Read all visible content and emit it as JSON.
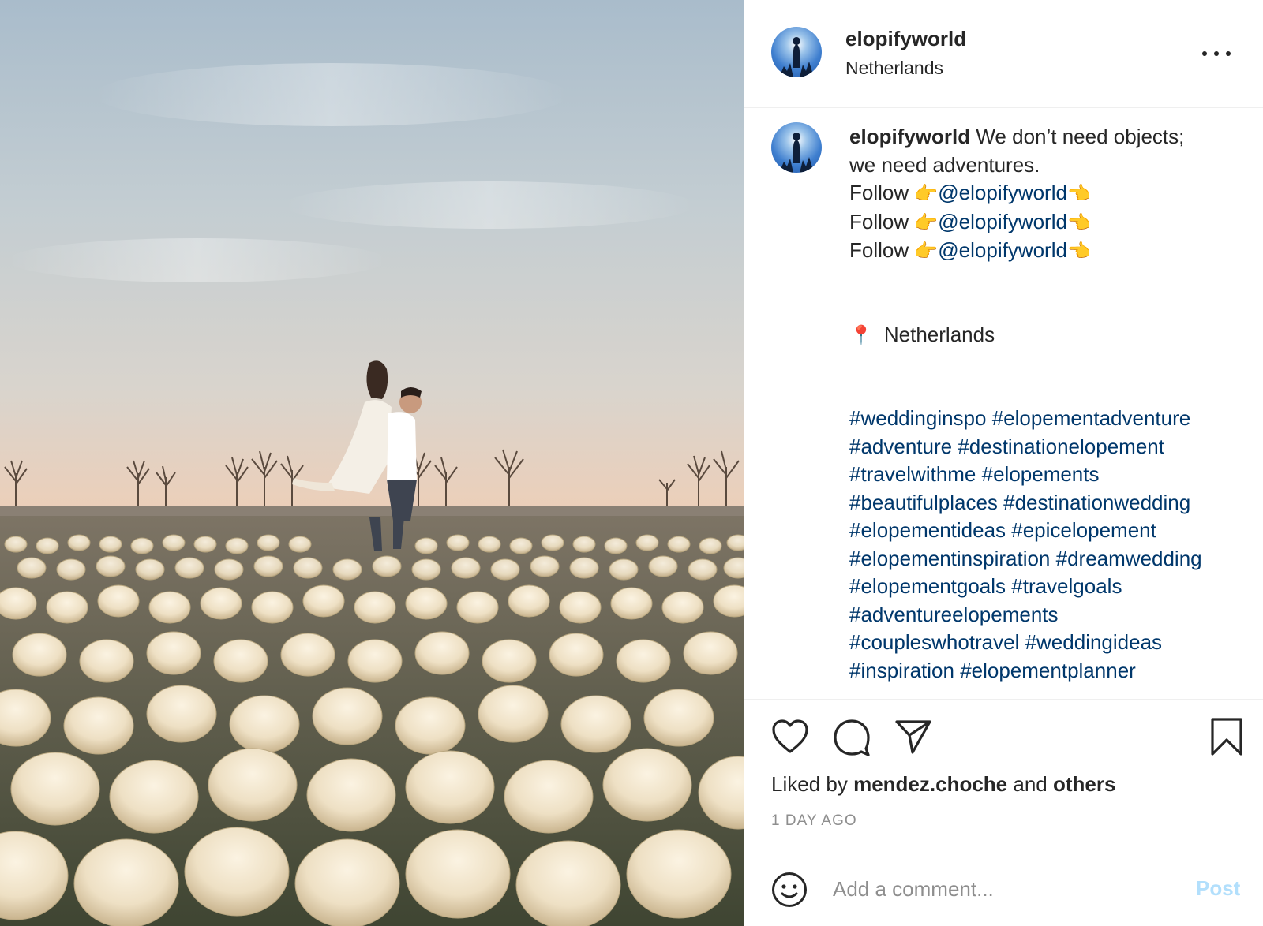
{
  "post": {
    "username": "elopifyworld",
    "location": "Netherlands"
  },
  "caption": {
    "username": "elopifyworld",
    "text_line1": " We don’t need objects;",
    "text_line2": "we need adventures.",
    "follow_lines": [
      {
        "word": "Follow",
        "emoji_left": "👉",
        "mention": "@elopifyworld",
        "emoji_right": "👈"
      },
      {
        "word": "Follow",
        "emoji_left": "👉",
        "mention": "@elopifyworld",
        "emoji_right": "👈"
      },
      {
        "word": "Follow",
        "emoji_left": "👉",
        "mention": "@elopifyworld",
        "emoji_right": "👈"
      }
    ],
    "location_pin": "📍",
    "location_text": "Netherlands",
    "hashtag_lines": [
      "#weddinginspo #elopementadventure",
      "#adventure #destinationelopement",
      "#travelwithme #elopements",
      "#beautifulplaces #destinationwedding",
      "#elopementideas #epicelopement",
      "#elopementinspiration #dreamwedding",
      "#elopementgoals #travelgoals",
      "#adventureelopements",
      "#coupleswhotravel #weddingideas",
      "#inspiration #elopementplanner"
    ]
  },
  "likes": {
    "prefix": "Liked by ",
    "user": "mendez.choche",
    "middle": " and ",
    "others": "others"
  },
  "timestamp": "1 DAY AGO",
  "comment_box": {
    "placeholder": "Add a comment...",
    "post_label": "Post"
  },
  "icons": {
    "more": "more-options-icon",
    "like": "heart-icon",
    "comment": "comment-bubble-icon",
    "share": "paper-plane-icon",
    "save": "bookmark-icon",
    "emoji": "smiley-icon"
  },
  "colors": {
    "text": "#262626",
    "link": "#00376b",
    "muted": "#8e8e8e",
    "post_disabled": "#b2dffc",
    "divider": "#efefef"
  }
}
